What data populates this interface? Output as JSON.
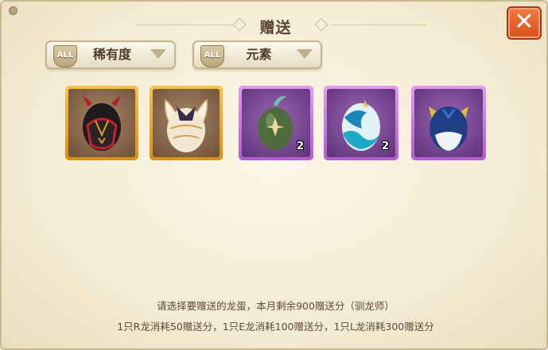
{
  "dialog": {
    "title": "赠送",
    "close_label": "✕"
  },
  "filters": [
    {
      "badge": "ALL",
      "label": "稀有度"
    },
    {
      "badge": "ALL",
      "label": "元素"
    }
  ],
  "eggs": [
    {
      "name": "dark-red-horned-egg",
      "frame": "orange",
      "count": ""
    },
    {
      "name": "white-gold-winged-egg",
      "frame": "orange",
      "count": ""
    },
    {
      "name": "green-leaf-egg",
      "frame": "purple",
      "count": "2"
    },
    {
      "name": "blue-wave-egg",
      "frame": "purple",
      "count": "2"
    },
    {
      "name": "navy-gold-egg",
      "frame": "purple",
      "count": ""
    }
  ],
  "footer": {
    "line1": "请选择要赠送的龙蛋，本月剩余900赠送分（驯龙师）",
    "line2": "1只R龙消耗50赠送分，1只E龙消耗100赠送分，1只L龙消耗300赠送分"
  },
  "colors": {
    "close": "#e0602a",
    "rare_frame": "#f0b83a",
    "epic_frame": "#c970e0",
    "text": "#5e4a36"
  }
}
